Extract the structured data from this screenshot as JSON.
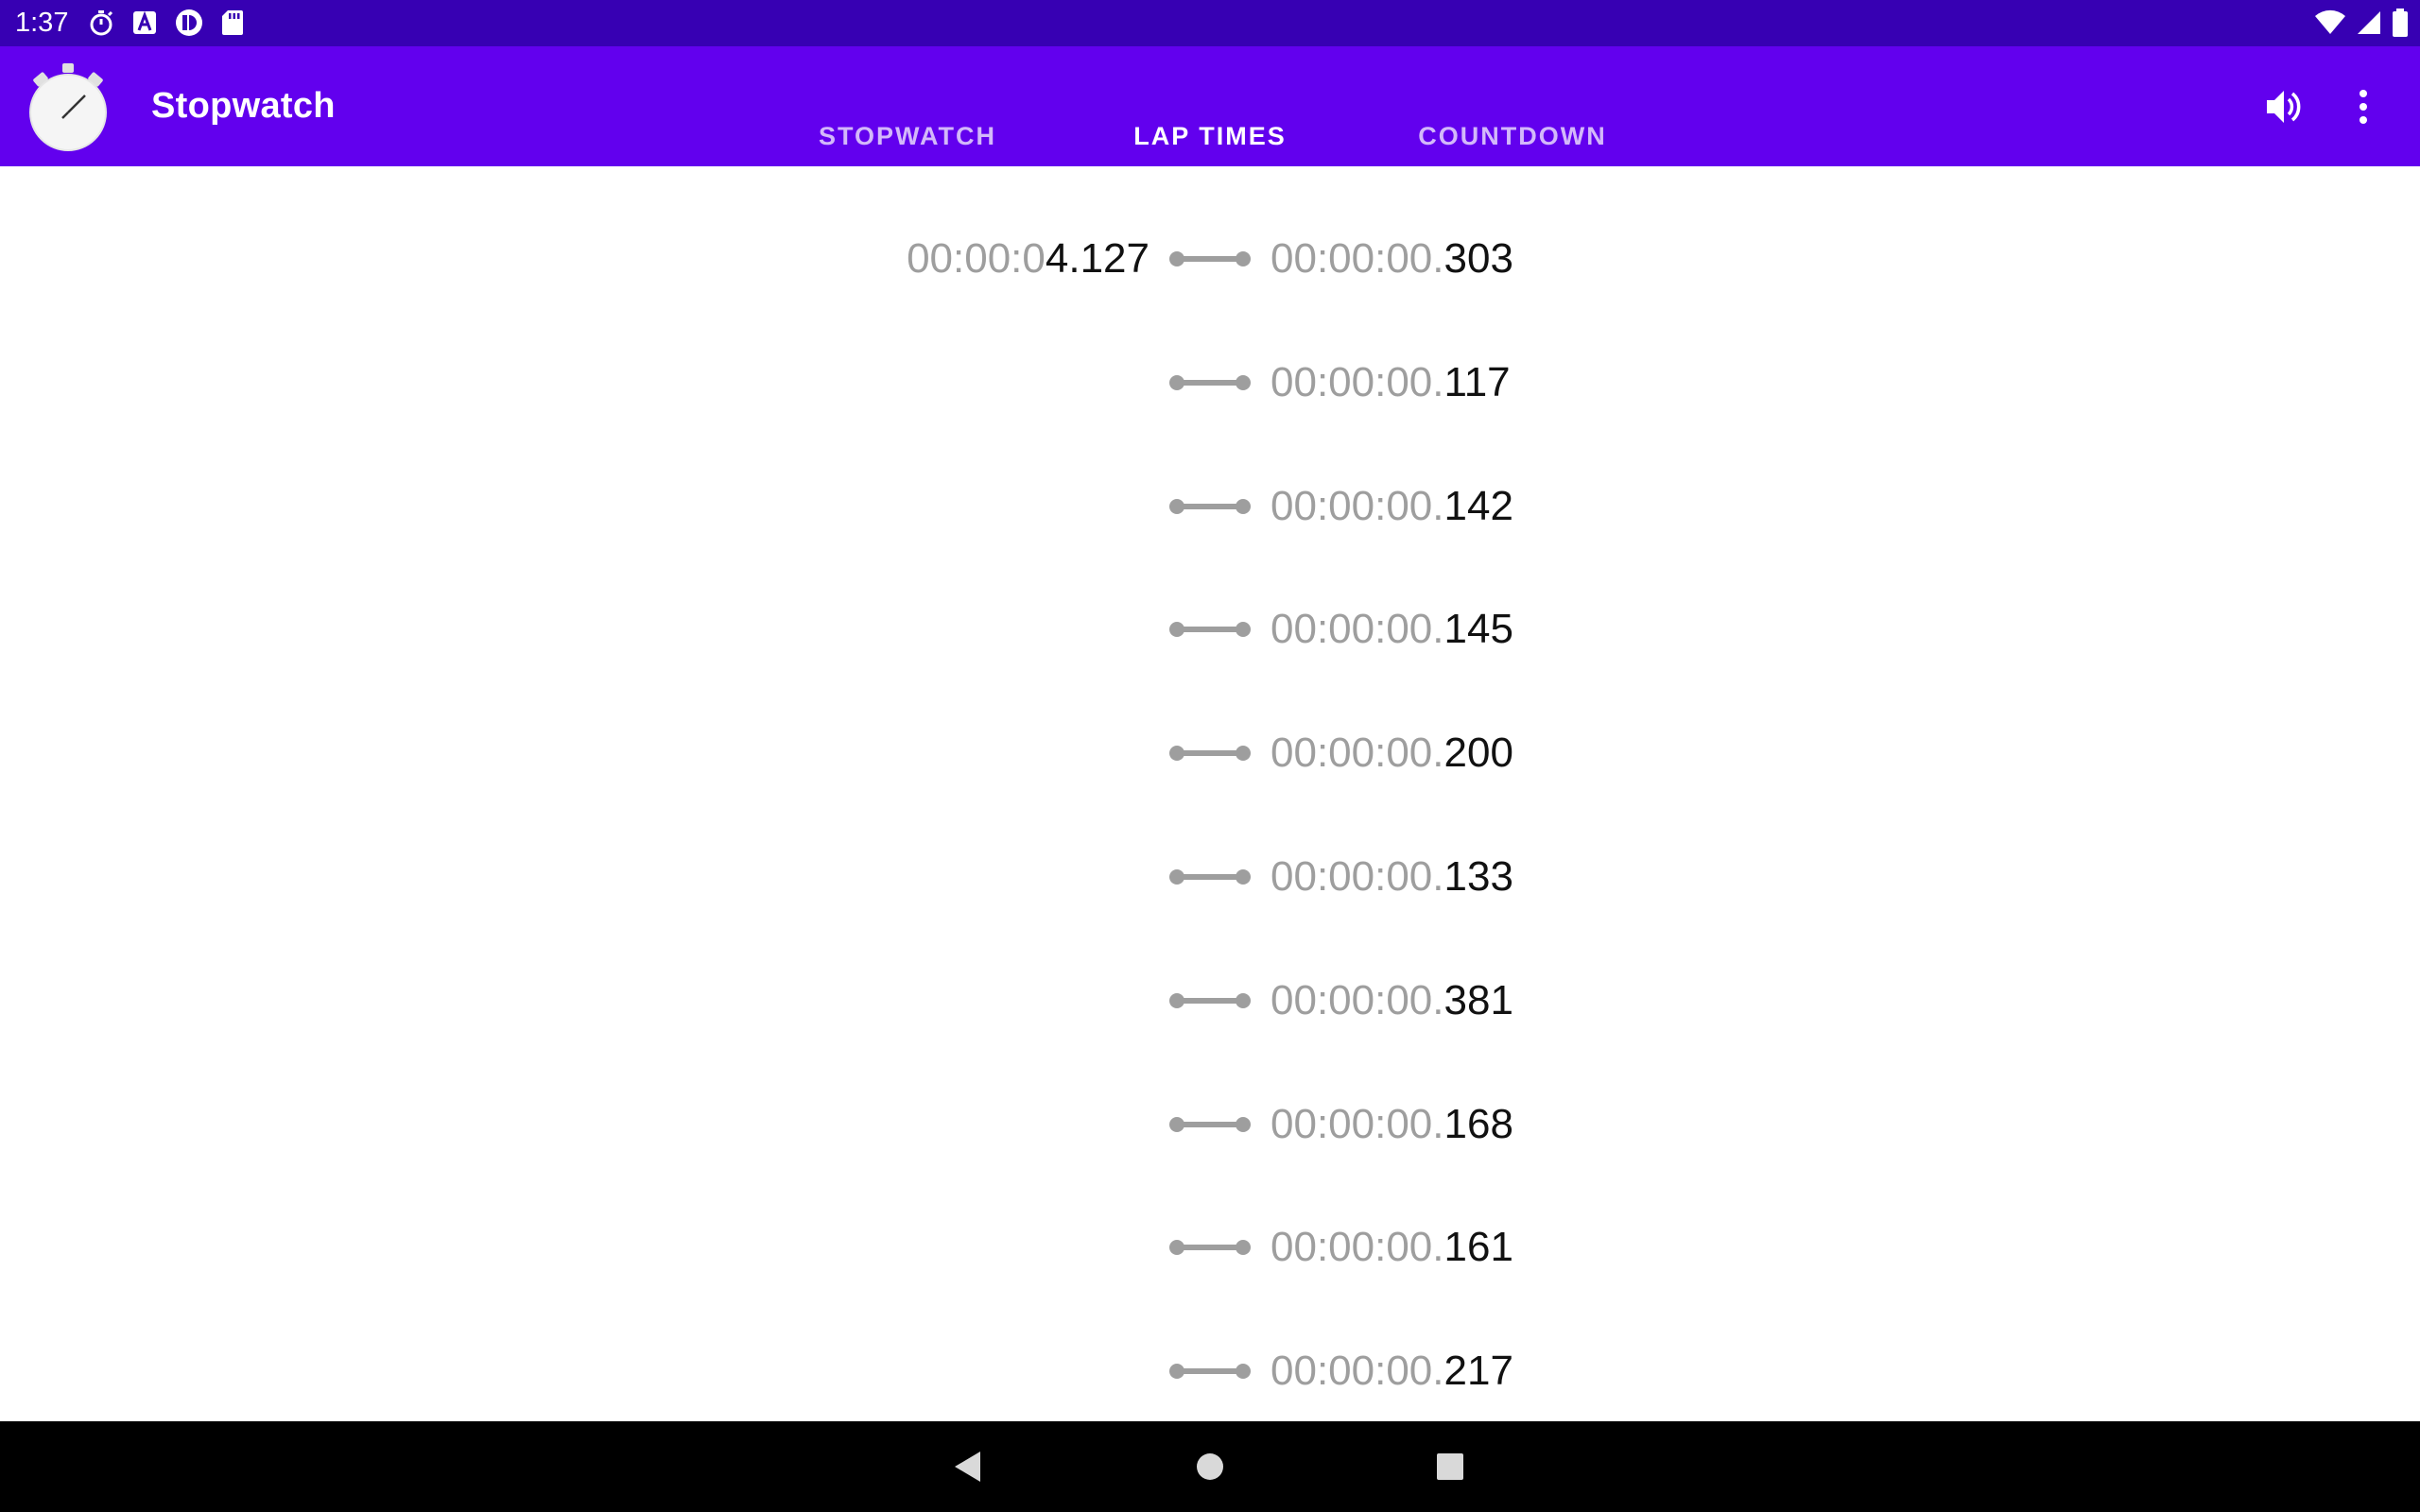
{
  "status_bar": {
    "time": "1:37",
    "left_icons": [
      "stopwatch-notification-icon",
      "font-a-icon",
      "app-notification-icon",
      "sd-card-icon"
    ],
    "right_icons": [
      "wifi-icon",
      "cell-signal-icon",
      "battery-icon"
    ]
  },
  "app_bar": {
    "title": "Stopwatch",
    "logo_icon": "stopwatch-logo-icon",
    "tabs": [
      {
        "label": "STOPWATCH",
        "active": false
      },
      {
        "label": "LAP TIMES",
        "active": true
      },
      {
        "label": "COUNTDOWN",
        "active": false
      }
    ],
    "actions": [
      "volume-icon",
      "overflow-menu-icon"
    ]
  },
  "laps": [
    {
      "total_dim": "00:00:0",
      "total_bright": "4.127",
      "split_dim": "00:00:00.",
      "split_bright": "303"
    },
    {
      "total_dim": "",
      "total_bright": "",
      "split_dim": "00:00:00.",
      "split_bright": "117"
    },
    {
      "total_dim": "",
      "total_bright": "",
      "split_dim": "00:00:00.",
      "split_bright": "142"
    },
    {
      "total_dim": "",
      "total_bright": "",
      "split_dim": "00:00:00.",
      "split_bright": "145"
    },
    {
      "total_dim": "",
      "total_bright": "",
      "split_dim": "00:00:00.",
      "split_bright": "200"
    },
    {
      "total_dim": "",
      "total_bright": "",
      "split_dim": "00:00:00.",
      "split_bright": "133"
    },
    {
      "total_dim": "",
      "total_bright": "",
      "split_dim": "00:00:00.",
      "split_bright": "381"
    },
    {
      "total_dim": "",
      "total_bright": "",
      "split_dim": "00:00:00.",
      "split_bright": "168"
    },
    {
      "total_dim": "",
      "total_bright": "",
      "split_dim": "00:00:00.",
      "split_bright": "161"
    },
    {
      "total_dim": "",
      "total_bright": "",
      "split_dim": "00:00:00.",
      "split_bright": "217"
    }
  ],
  "nav_bar": {
    "buttons": [
      "back-icon",
      "home-icon",
      "recents-icon"
    ]
  },
  "colors": {
    "status_bar": "#3700b3",
    "app_bar": "#6200ee",
    "dim_text": "#9e9e9e",
    "bright_text": "#111111",
    "connector": "#9e9e9e"
  }
}
